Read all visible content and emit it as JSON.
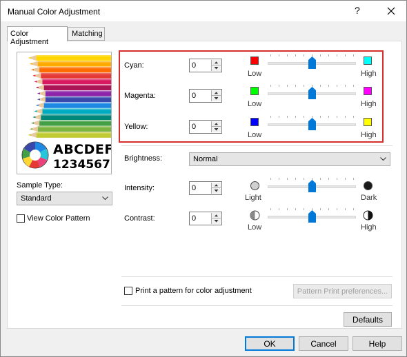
{
  "window": {
    "title": "Manual Color Adjustment",
    "help_label": "?"
  },
  "tabs": [
    {
      "label": "Color Adjustment",
      "active": true
    },
    {
      "label": "Matching",
      "active": false
    }
  ],
  "preview": {
    "letters": "ABCDEF",
    "digits": "1234567"
  },
  "sample_type": {
    "label": "Sample Type:",
    "value": "Standard"
  },
  "view_color_pattern": {
    "label": "View Color Pattern",
    "checked": false
  },
  "color_balance": [
    {
      "label": "Cyan:",
      "value": "0",
      "low_label": "Low",
      "high_label": "High",
      "low_color": "#ff0000",
      "high_color": "#00ffff",
      "level": 0.5
    },
    {
      "label": "Magenta:",
      "value": "0",
      "low_label": "Low",
      "high_label": "High",
      "low_color": "#00ff00",
      "high_color": "#ff00ff",
      "level": 0.5
    },
    {
      "label": "Yellow:",
      "value": "0",
      "low_label": "Low",
      "high_label": "High",
      "low_color": "#0000ff",
      "high_color": "#ffff00",
      "level": 0.5
    }
  ],
  "brightness": {
    "label": "Brightness:",
    "value": "Normal"
  },
  "intensity": {
    "label": "Intensity:",
    "value": "0",
    "low_label": "Light",
    "high_label": "Dark",
    "level": 0.5
  },
  "contrast": {
    "label": "Contrast:",
    "value": "0",
    "low_label": "Low",
    "high_label": "High",
    "level": 0.5
  },
  "print_pattern": {
    "label": "Print a pattern for color adjustment",
    "checked": false
  },
  "buttons": {
    "pattern_print_preferences": "Pattern Print preferences...",
    "defaults": "Defaults",
    "ok": "OK",
    "cancel": "Cancel",
    "help": "Help"
  },
  "colors": {
    "accent": "#0078d7",
    "highlight_border": "#d32f2f"
  }
}
